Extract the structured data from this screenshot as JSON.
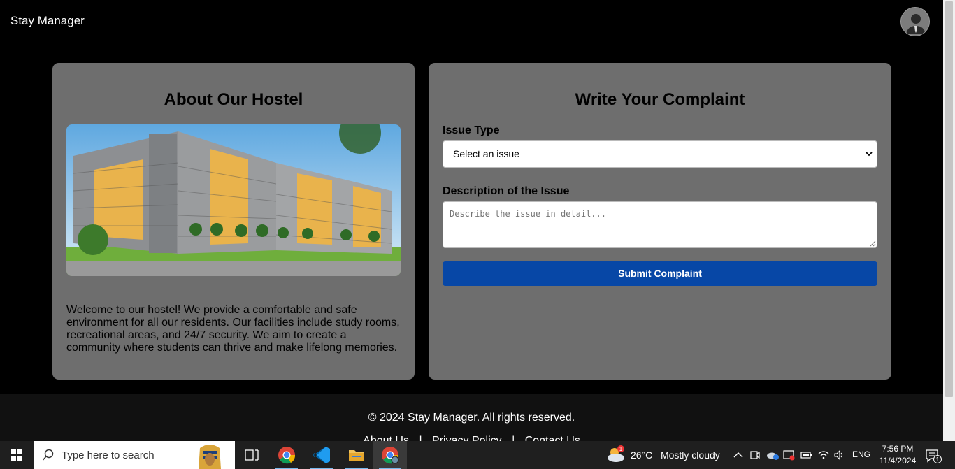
{
  "app": {
    "brand": "Stay Manager"
  },
  "about": {
    "title": "About Our Hostel",
    "text": "Welcome to our hostel! We provide a comfortable and safe environment for all our residents. Our facilities include study rooms, recreational areas, and 24/7 security. We aim to create a community where students can thrive and make lifelong memories."
  },
  "complaint": {
    "title": "Write Your Complaint",
    "issue_label": "Issue Type",
    "issue_selected": "Select an issue",
    "desc_label": "Description of the Issue",
    "desc_placeholder": "Describe the issue in detail...",
    "submit_label": "Submit Complaint"
  },
  "footer": {
    "copyright": "© 2024 Stay Manager. All rights reserved.",
    "links": [
      "About Us",
      "Privacy Policy",
      "Contact Us"
    ],
    "separator": "|"
  },
  "taskbar": {
    "search_placeholder": "Type here to search",
    "weather_temp": "26°C",
    "weather_text": "Mostly cloudy",
    "weather_badge": "1",
    "language": "ENG",
    "time": "7:56 PM",
    "date": "11/4/2024",
    "notification_count": "1"
  },
  "colors": {
    "card_bg": "#6e6e6e",
    "submit_bg": "#0747a6",
    "page_bg": "#000000"
  }
}
